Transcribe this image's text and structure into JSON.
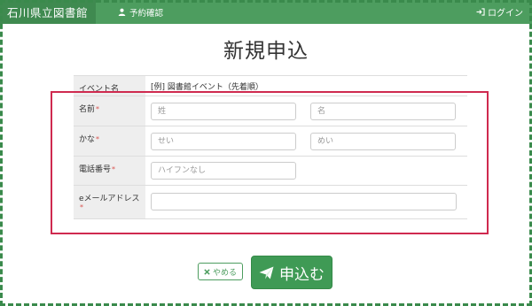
{
  "navbar": {
    "brand": "石川県立図書館",
    "reserve_link": "予約確認",
    "login_link": "ログイン",
    "color": "#4d9d5f"
  },
  "page": {
    "title": "新規申込"
  },
  "form": {
    "event": {
      "label": "イベント名",
      "value": "[例] 図書館イベント（先着順）"
    },
    "name": {
      "label": "名前",
      "required_mark": "*",
      "last_placeholder": "姓",
      "first_placeholder": "名"
    },
    "kana": {
      "label": "かな",
      "required_mark": "*",
      "last_placeholder": "せい",
      "first_placeholder": "めい"
    },
    "phone": {
      "label": "電話番号",
      "required_mark": "*",
      "placeholder": "ハイフンなし"
    },
    "email": {
      "label": "eメールアドレス",
      "required_mark": "*",
      "placeholder": ""
    }
  },
  "actions": {
    "cancel_label": "やめる",
    "submit_label": "申込む"
  },
  "colors": {
    "accent": "#3f9a55",
    "highlight": "#cf2a4f",
    "required": "#d9534f"
  }
}
